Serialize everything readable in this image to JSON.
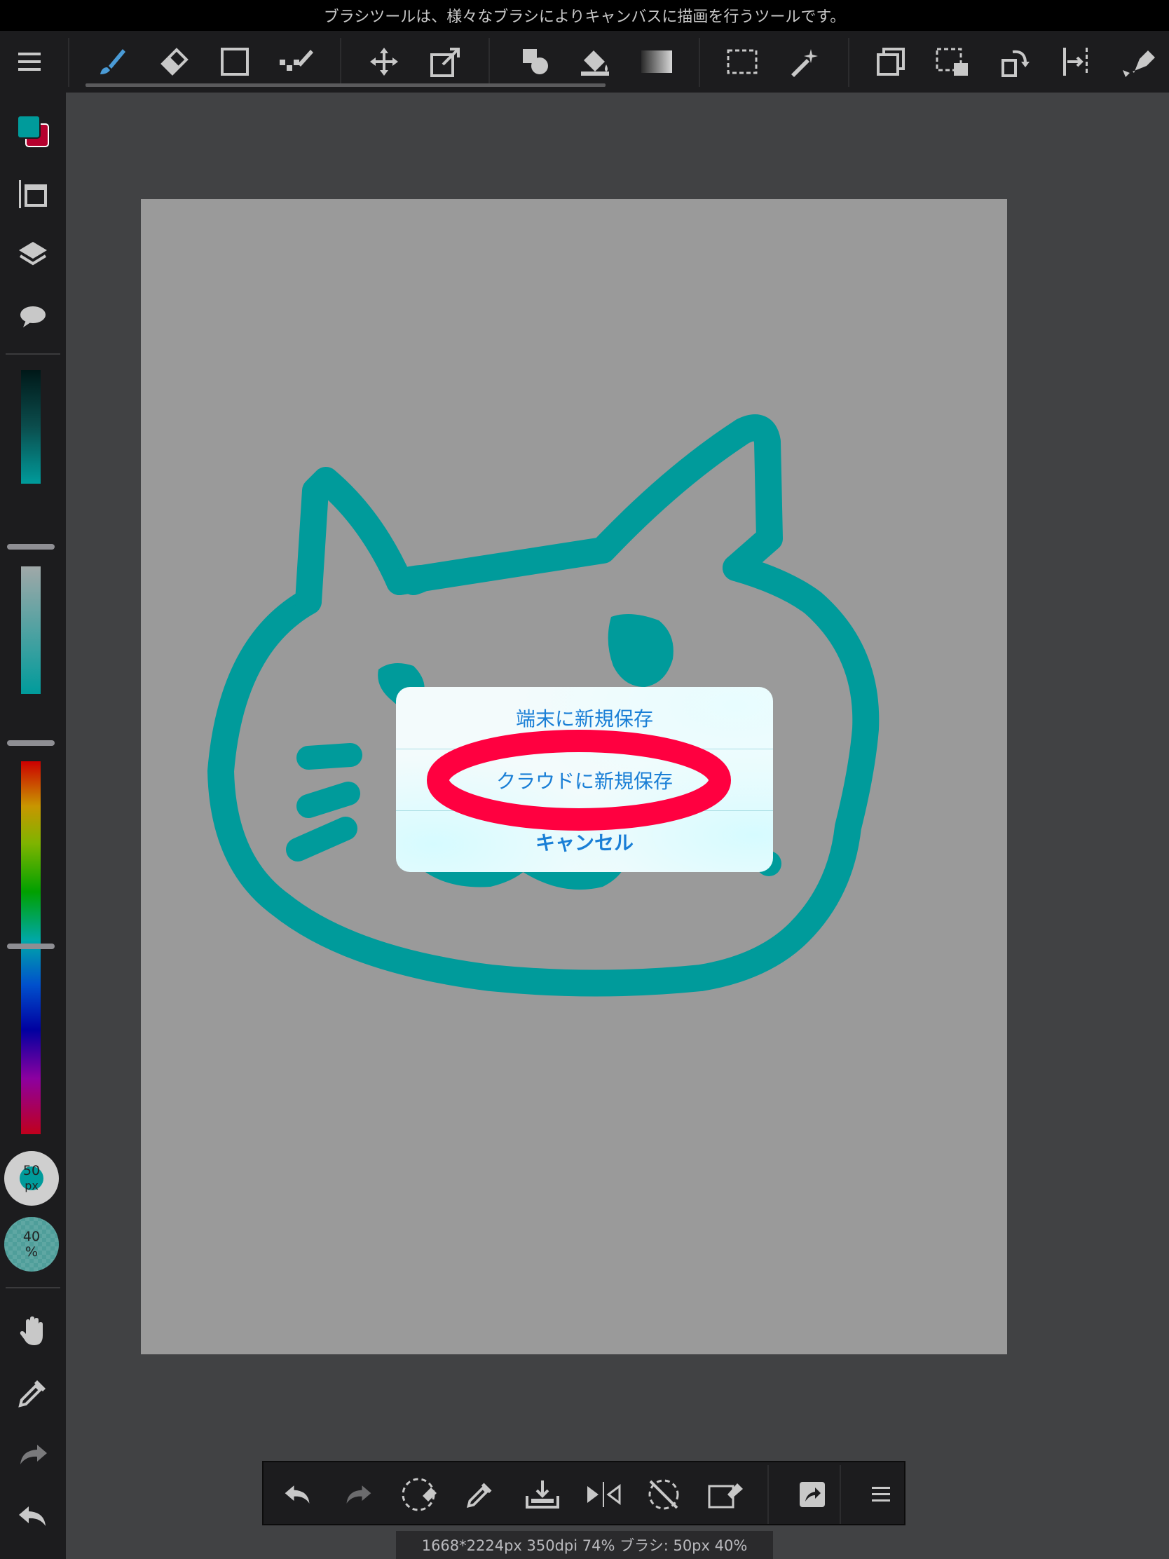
{
  "tooltip": "ブラシツールは、様々なブラシによりキャンバスに描画を行うツールです。",
  "top_toolbar": {
    "tools": [
      "menu-icon",
      "brush-icon",
      "eraser-icon",
      "rectangle-icon",
      "dot-pen-icon",
      "move-icon",
      "transform-icon",
      "fill-shape-icon",
      "bucket-icon",
      "gradient-icon",
      "select-rect-icon",
      "magic-wand-icon",
      "copy-layer-icon",
      "select-paste-icon",
      "rotate-icon",
      "ruler-icon",
      "pen-tool-icon"
    ],
    "active_tool": "brush-icon"
  },
  "left_bar": {
    "primary_color": "#009b9b",
    "secondary_color": "#b5002e",
    "brush_size": "50",
    "brush_size_unit": "px",
    "brush_opacity": "40",
    "brush_opacity_unit": "%"
  },
  "dialog": {
    "option_save_device": "端末に新規保存",
    "option_save_cloud": "クラウドに新規保存",
    "option_cancel": "キャンセル",
    "highlight_color": "#ff0040"
  },
  "status": "1668*2224px 350dpi 74% ブラシ: 50px 40%",
  "drawing": {
    "stroke_color": "#009b9b",
    "canvas_color": "#9a9a9a"
  }
}
